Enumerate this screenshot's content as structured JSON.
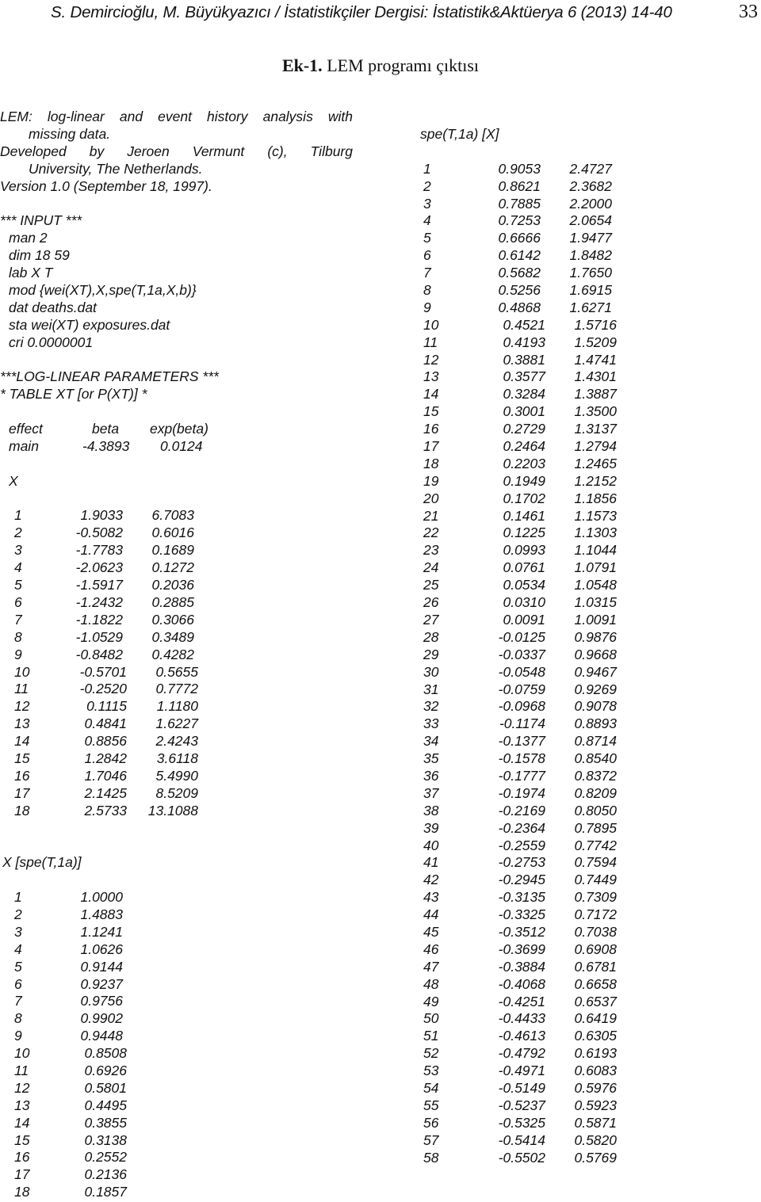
{
  "header": {
    "citation": "S. Demircioğlu, M. Büyükyazıcı / İstatistikçiler Dergisi: İstatistik&Aktüerya 6 (2013) 14-40",
    "page_number": "33"
  },
  "title": {
    "bold": "Ek-1.",
    "rest": " LEM programı çıktısı"
  },
  "intro": {
    "line1": "LEM: log-linear and event history analysis with",
    "line1b": "missing data.",
    "line2": "Developed by Jeroen Vermunt (c), Tilburg",
    "line2b": "University, The Netherlands.",
    "line3": "Version 1.0 (September 18, 1997)."
  },
  "input": {
    "heading": "*** INPUT ***",
    "lines": [
      "man 2",
      "dim 18 59",
      "lab X T",
      "mod {wei(XT),X,spe(T,1a,X,b)}",
      "dat deaths.dat",
      "sta wei(XT) exposures.dat",
      "cri 0.0000001"
    ]
  },
  "params": {
    "heading": "***LOG-LINEAR PARAMETERS ***",
    "table_heading": "* TABLE XT [or P(XT)] *",
    "columns": [
      "effect",
      "beta",
      "exp(beta)"
    ],
    "main": {
      "label": "main",
      "beta": "-4.3893",
      "exp": "0.0124"
    },
    "x_label": "X",
    "x_rows": [
      {
        "i": "1",
        "beta": "1.9033",
        "exp": "6.7083"
      },
      {
        "i": "2",
        "beta": "-0.5082",
        "exp": "0.6016"
      },
      {
        "i": "3",
        "beta": "-1.7783",
        "exp": "0.1689"
      },
      {
        "i": "4",
        "beta": "-2.0623",
        "exp": "0.1272"
      },
      {
        "i": "5",
        "beta": "-1.5917",
        "exp": "0.2036"
      },
      {
        "i": "6",
        "beta": "-1.2432",
        "exp": "0.2885"
      },
      {
        "i": "7",
        "beta": "-1.1822",
        "exp": "0.3066"
      },
      {
        "i": "8",
        "beta": "-1.0529",
        "exp": "0.3489"
      },
      {
        "i": "9",
        "beta": "-0.8482",
        "exp": "0.4282"
      },
      {
        "i": "10",
        "beta": "-0.5701",
        "exp": "0.5655"
      },
      {
        "i": "11",
        "beta": "-0.2520",
        "exp": "0.7772"
      },
      {
        "i": "12",
        "beta": "0.1115",
        "exp": "1.1180"
      },
      {
        "i": "13",
        "beta": "0.4841",
        "exp": "1.6227"
      },
      {
        "i": "14",
        "beta": "0.8856",
        "exp": "2.4243"
      },
      {
        "i": "15",
        "beta": "1.2842",
        "exp": "3.6118"
      },
      {
        "i": "16",
        "beta": "1.7046",
        "exp": "5.4990"
      },
      {
        "i": "17",
        "beta": "2.1425",
        "exp": "8.5209"
      },
      {
        "i": "18",
        "beta": "2.5733",
        "exp": "13.1088"
      }
    ],
    "xspe_label": "X [spe(T,1a)]",
    "xspe_rows": [
      {
        "i": "1",
        "v": "1.0000"
      },
      {
        "i": "2",
        "v": "1.4883"
      },
      {
        "i": "3",
        "v": "1.1241"
      },
      {
        "i": "4",
        "v": "1.0626"
      },
      {
        "i": "5",
        "v": "0.9144"
      },
      {
        "i": "6",
        "v": "0.9237"
      },
      {
        "i": "7",
        "v": "0.9756"
      },
      {
        "i": "8",
        "v": "0.9902"
      },
      {
        "i": "9",
        "v": "0.9448"
      },
      {
        "i": "10",
        "v": "0.8508"
      },
      {
        "i": "11",
        "v": "0.6926"
      },
      {
        "i": "12",
        "v": "0.5801"
      },
      {
        "i": "13",
        "v": "0.4495"
      },
      {
        "i": "14",
        "v": "0.3855"
      },
      {
        "i": "15",
        "v": "0.3138"
      },
      {
        "i": "16",
        "v": "0.2552"
      },
      {
        "i": "17",
        "v": "0.2136"
      },
      {
        "i": "18",
        "v": "0.1857"
      }
    ]
  },
  "spe": {
    "label": "spe(T,1a) [X]",
    "rows": [
      {
        "i": "1",
        "beta": "0.9053",
        "exp": "2.4727"
      },
      {
        "i": "2",
        "beta": "0.8621",
        "exp": "2.3682"
      },
      {
        "i": "3",
        "beta": "0.7885",
        "exp": "2.2000"
      },
      {
        "i": "4",
        "beta": "0.7253",
        "exp": "2.0654"
      },
      {
        "i": "5",
        "beta": "0.6666",
        "exp": "1.9477"
      },
      {
        "i": "6",
        "beta": "0.6142",
        "exp": "1.8482"
      },
      {
        "i": "7",
        "beta": "0.5682",
        "exp": "1.7650"
      },
      {
        "i": "8",
        "beta": "0.5256",
        "exp": "1.6915"
      },
      {
        "i": "9",
        "beta": "0.4868",
        "exp": "1.6271"
      },
      {
        "i": "10",
        "beta": "0.4521",
        "exp": "1.5716"
      },
      {
        "i": "11",
        "beta": "0.4193",
        "exp": "1.5209"
      },
      {
        "i": "12",
        "beta": "0.3881",
        "exp": "1.4741"
      },
      {
        "i": "13",
        "beta": "0.3577",
        "exp": "1.4301"
      },
      {
        "i": "14",
        "beta": "0.3284",
        "exp": "1.3887"
      },
      {
        "i": "15",
        "beta": "0.3001",
        "exp": "1.3500"
      },
      {
        "i": "16",
        "beta": "0.2729",
        "exp": "1.3137"
      },
      {
        "i": "17",
        "beta": "0.2464",
        "exp": "1.2794"
      },
      {
        "i": "18",
        "beta": "0.2203",
        "exp": "1.2465"
      },
      {
        "i": "19",
        "beta": "0.1949",
        "exp": "1.2152"
      },
      {
        "i": "20",
        "beta": "0.1702",
        "exp": "1.1856"
      },
      {
        "i": "21",
        "beta": "0.1461",
        "exp": "1.1573"
      },
      {
        "i": "22",
        "beta": "0.1225",
        "exp": "1.1303"
      },
      {
        "i": "23",
        "beta": "0.0993",
        "exp": "1.1044"
      },
      {
        "i": "24",
        "beta": "0.0761",
        "exp": "1.0791"
      },
      {
        "i": "25",
        "beta": "0.0534",
        "exp": "1.0548"
      },
      {
        "i": "26",
        "beta": "0.0310",
        "exp": "1.0315"
      },
      {
        "i": "27",
        "beta": "0.0091",
        "exp": "1.0091"
      },
      {
        "i": "28",
        "beta": "-0.0125",
        "exp": "0.9876"
      },
      {
        "i": "29",
        "beta": "-0.0337",
        "exp": "0.9668"
      },
      {
        "i": "30",
        "beta": "-0.0548",
        "exp": "0.9467"
      },
      {
        "i": "31",
        "beta": "-0.0759",
        "exp": "0.9269"
      },
      {
        "i": "32",
        "beta": "-0.0968",
        "exp": "0.9078"
      },
      {
        "i": "33",
        "beta": "-0.1174",
        "exp": "0.8893"
      },
      {
        "i": "34",
        "beta": "-0.1377",
        "exp": "0.8714"
      },
      {
        "i": "35",
        "beta": "-0.1578",
        "exp": "0.8540"
      },
      {
        "i": "36",
        "beta": "-0.1777",
        "exp": "0.8372"
      },
      {
        "i": "37",
        "beta": "-0.1974",
        "exp": "0.8209"
      },
      {
        "i": "38",
        "beta": "-0.2169",
        "exp": "0.8050"
      },
      {
        "i": "39",
        "beta": "-0.2364",
        "exp": "0.7895"
      },
      {
        "i": "40",
        "beta": "-0.2559",
        "exp": "0.7742"
      },
      {
        "i": "41",
        "beta": "-0.2753",
        "exp": "0.7594"
      },
      {
        "i": "42",
        "beta": "-0.2945",
        "exp": "0.7449"
      },
      {
        "i": "43",
        "beta": "-0.3135",
        "exp": "0.7309"
      },
      {
        "i": "44",
        "beta": "-0.3325",
        "exp": "0.7172"
      },
      {
        "i": "45",
        "beta": "-0.3512",
        "exp": "0.7038"
      },
      {
        "i": "46",
        "beta": "-0.3699",
        "exp": "0.6908"
      },
      {
        "i": "47",
        "beta": "-0.3884",
        "exp": "0.6781"
      },
      {
        "i": "48",
        "beta": "-0.4068",
        "exp": "0.6658"
      },
      {
        "i": "49",
        "beta": "-0.4251",
        "exp": "0.6537"
      },
      {
        "i": "50",
        "beta": "-0.4433",
        "exp": "0.6419"
      },
      {
        "i": "51",
        "beta": "-0.4613",
        "exp": "0.6305"
      },
      {
        "i": "52",
        "beta": "-0.4792",
        "exp": "0.6193"
      },
      {
        "i": "53",
        "beta": "-0.4971",
        "exp": "0.6083"
      },
      {
        "i": "54",
        "beta": "-0.5149",
        "exp": "0.5976"
      },
      {
        "i": "55",
        "beta": "-0.5237",
        "exp": "0.5923"
      },
      {
        "i": "56",
        "beta": "-0.5325",
        "exp": "0.5871"
      },
      {
        "i": "57",
        "beta": "-0.5414",
        "exp": "0.5820"
      },
      {
        "i": "58",
        "beta": "-0.5502",
        "exp": "0.5769"
      }
    ]
  }
}
